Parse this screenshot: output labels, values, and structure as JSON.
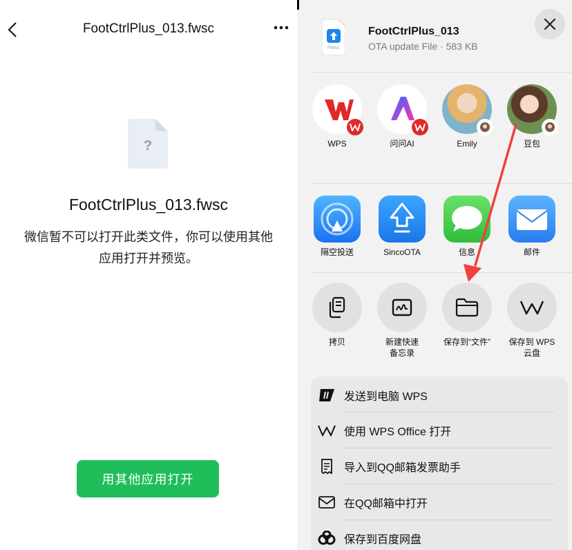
{
  "left": {
    "title": "FootCtrlPlus_013.fwsc",
    "file_icon_glyph": "?",
    "file_name": "FootCtrlPlus_013.fwsc",
    "message": "微信暂不可以打开此类文件，你可以使用其他应用打开并预览。",
    "open_button": "用其他应用打开",
    "accent": "#1fbe5a",
    "icons": [
      "chevron-left-icon",
      "more-icon",
      "unknown-file-icon"
    ]
  },
  "sheet": {
    "file_title": "FootCtrlPlus_013",
    "file_subtitle": "OTA update File · 583 KB",
    "thumb_caption": "FWSC",
    "apps": [
      {
        "label": "WPS",
        "icon": "wps-app-icon"
      },
      {
        "label": "问问AI",
        "icon": "wenwen-ai-app-icon"
      },
      {
        "label": "Emily",
        "icon": "contact-avatar-emily"
      },
      {
        "label": "豆包",
        "icon": "doubao-app-icon"
      }
    ],
    "share_apps": [
      {
        "label": "隔空投送",
        "icon": "airdrop-icon"
      },
      {
        "label": "SincoOTA",
        "icon": "sincoota-icon"
      },
      {
        "label": "信息",
        "icon": "messages-icon"
      },
      {
        "label": "邮件",
        "icon": "mail-icon"
      }
    ],
    "actions": [
      {
        "label": "拷贝",
        "icon": "copy-icon"
      },
      {
        "label": "新建快速备忘录",
        "line1": "新建快速",
        "line2": "备忘录",
        "icon": "quick-note-icon"
      },
      {
        "label": "保存到“文件”",
        "icon": "folder-icon"
      },
      {
        "label": "保存到 WPS 云盘",
        "line1": "保存到 WPS",
        "line2": "云盘",
        "icon": "wps-cloud-icon"
      }
    ],
    "menu": [
      {
        "label": "发送到电脑 WPS",
        "icon": "wps-pc-icon"
      },
      {
        "label": "使用 WPS Office 打开",
        "icon": "wps-logo-icon"
      },
      {
        "label": "导入到QQ邮箱发票助手",
        "icon": "receipt-icon"
      },
      {
        "label": "在QQ邮箱中打开",
        "icon": "envelope-icon"
      },
      {
        "label": "保存到百度网盘",
        "icon": "baidu-netdisk-icon"
      }
    ],
    "annotation": {
      "type": "red-arrow",
      "color": "#f04040",
      "points_to": "保存到“文件”"
    }
  }
}
